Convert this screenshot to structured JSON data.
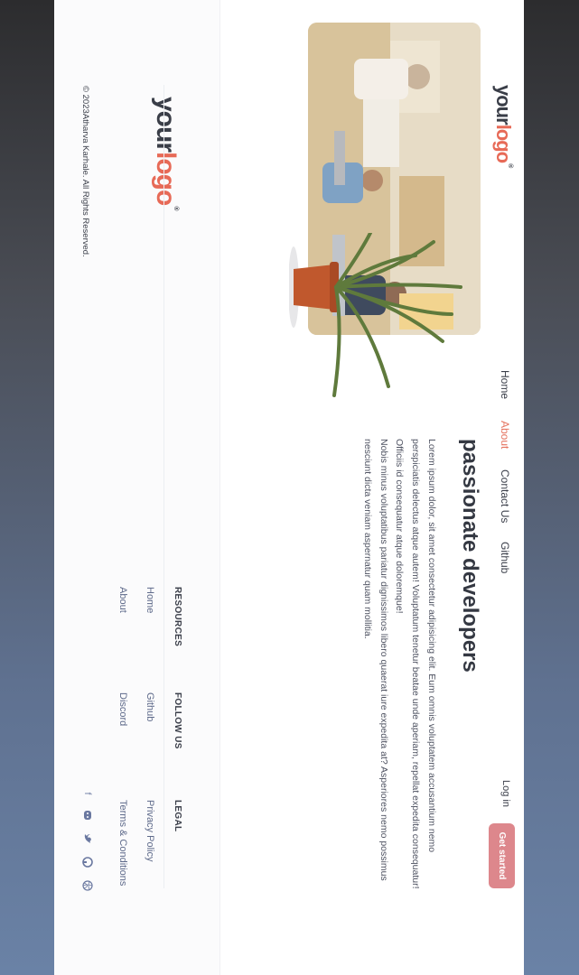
{
  "header": {
    "logo": {
      "part1": "your",
      "part2": "logo",
      "reg": "®"
    },
    "nav": [
      {
        "label": "Home"
      },
      {
        "label": "About"
      },
      {
        "label": "Contact Us"
      },
      {
        "label": "Github"
      }
    ],
    "login": "Log in",
    "cta": "Get started"
  },
  "hero": {
    "headline": "passionate developers",
    "paragraph1": "Lorem ipsum dolor, sit amet consectetur adipisicing elit. Eum omnis voluptatem accusantium nemo perspiciatis delectus atque autem! Voluptatum tenetur beatae unde aperiam, repellat expedita consequatur! Officiis id consequatur atque doloremque!",
    "paragraph2": "Nobis minus voluptatibus pariatur dignissimos libero quaerat iure expedita at? Asperiores nemo possimus nesciunt dicta veniam aspernatur quam mollitia."
  },
  "footer": {
    "logo": {
      "part1": "your",
      "part2": "logo",
      "reg": "®"
    },
    "columns": [
      {
        "heading": "RESOURCES",
        "links": [
          "Home",
          "About"
        ]
      },
      {
        "heading": "FOLLOW US",
        "links": [
          "Github",
          "Discord"
        ]
      },
      {
        "heading": "LEGAL",
        "links": [
          "Privacy Policy",
          "Terms & Conditions"
        ]
      }
    ],
    "copyright": "© 2023Atharva Karhale. All Rights Reserved.",
    "social_icons": [
      "facebook-icon",
      "discord-icon",
      "twitter-icon",
      "github-icon",
      "dribbble-icon"
    ]
  },
  "colors": {
    "accent": "#e76a57",
    "cta": "#dd878c",
    "text": "#343842"
  }
}
